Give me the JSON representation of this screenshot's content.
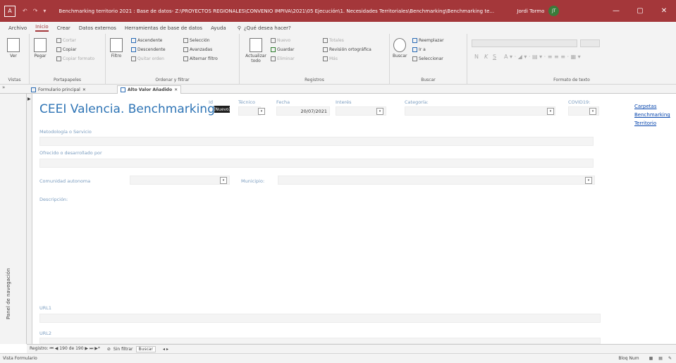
{
  "titlebar": {
    "app_icon": "access-icon",
    "qat": [
      "↶",
      "↷",
      "▾"
    ],
    "title": "Benchmarking territorio 2021 : Base de datos- Z:\\PROYECTOS REGIONALES\\CONVENIO IMPIVA\\2021\\05 Ejecución\\1. Necesidades Territoriales\\Benchmarking\\Benchmarking te...",
    "user": "Jordi Tormo",
    "user_initials": "JT",
    "minimize": "—",
    "maximize": "▢",
    "close": "✕"
  },
  "menu": [
    "Archivo",
    "Inicio",
    "Crear",
    "Datos externos",
    "Herramientas de base de datos",
    "Ayuda"
  ],
  "menu_active": "Inicio",
  "tell_me": "¿Qué desea hacer?",
  "ribbon": {
    "vistas": {
      "label": "Vistas",
      "ver": "Ver"
    },
    "portapapeles": {
      "label": "Portapapeles",
      "pegar": "Pegar",
      "cortar": "Cortar",
      "copiar": "Copiar",
      "copiar_formato": "Copiar formato"
    },
    "ordenar": {
      "label": "Ordenar y filtrar",
      "filtro": "Filtro",
      "ascendente": "Ascendente",
      "descendente": "Descendente",
      "quitar_orden": "Quitar orden",
      "seleccion": "Selección",
      "avanzadas": "Avanzadas",
      "alternar": "Alternar filtro"
    },
    "registros": {
      "label": "Registros",
      "actualizar": "Actualizar todo",
      "nuevo": "Nuevo",
      "guardar": "Guardar",
      "eliminar": "Eliminar",
      "totales": "Totales",
      "revision": "Revisión ortográfica",
      "mas": "Más"
    },
    "buscar": {
      "label": "Buscar",
      "buscar": "Buscar",
      "reemplazar": "Reemplazar",
      "ir_a": "Ir a",
      "seleccionar": "Seleccionar"
    },
    "formato": {
      "label": "Formato de texto",
      "n": "N",
      "k": "K",
      "s": "S"
    }
  },
  "tabs": [
    {
      "label": "Formulario principal"
    },
    {
      "label": "Alto Valor Añadido"
    }
  ],
  "nav_pane_label": "Panel de navegación",
  "form": {
    "title": "CEEI Valencia. Benchmarking",
    "id_label": "Id",
    "id_value": "(Nuevo)",
    "tecnico_label": "Técnico",
    "fecha_label": "Fecha",
    "fecha_value": "20/07/2021",
    "interes_label": "Interés",
    "categoria_label": "Categoría:",
    "covid_label": "COVID19:",
    "links": [
      "Carpetas",
      "Benchmarking",
      "Territorio"
    ],
    "metodologia_label": "Metodología o Servicio",
    "ofrecido_label": "Ofrecido o desarrollado por",
    "comunidad_label": "Comunidad autonoma",
    "municipio_label": "Municipio:",
    "descripcion_label": "Descripción:",
    "url1_label": "URL1",
    "url2_label": "URL2"
  },
  "recordbar": {
    "registro": "Registro: ⏮ ◀ 190 de 190 ▶ ⏭ ▶*",
    "sin_filtro": "Sin filtrar",
    "buscar": "Buscar"
  },
  "statusbar": {
    "view": "Vista Formulario",
    "num": "Bloq Num"
  }
}
